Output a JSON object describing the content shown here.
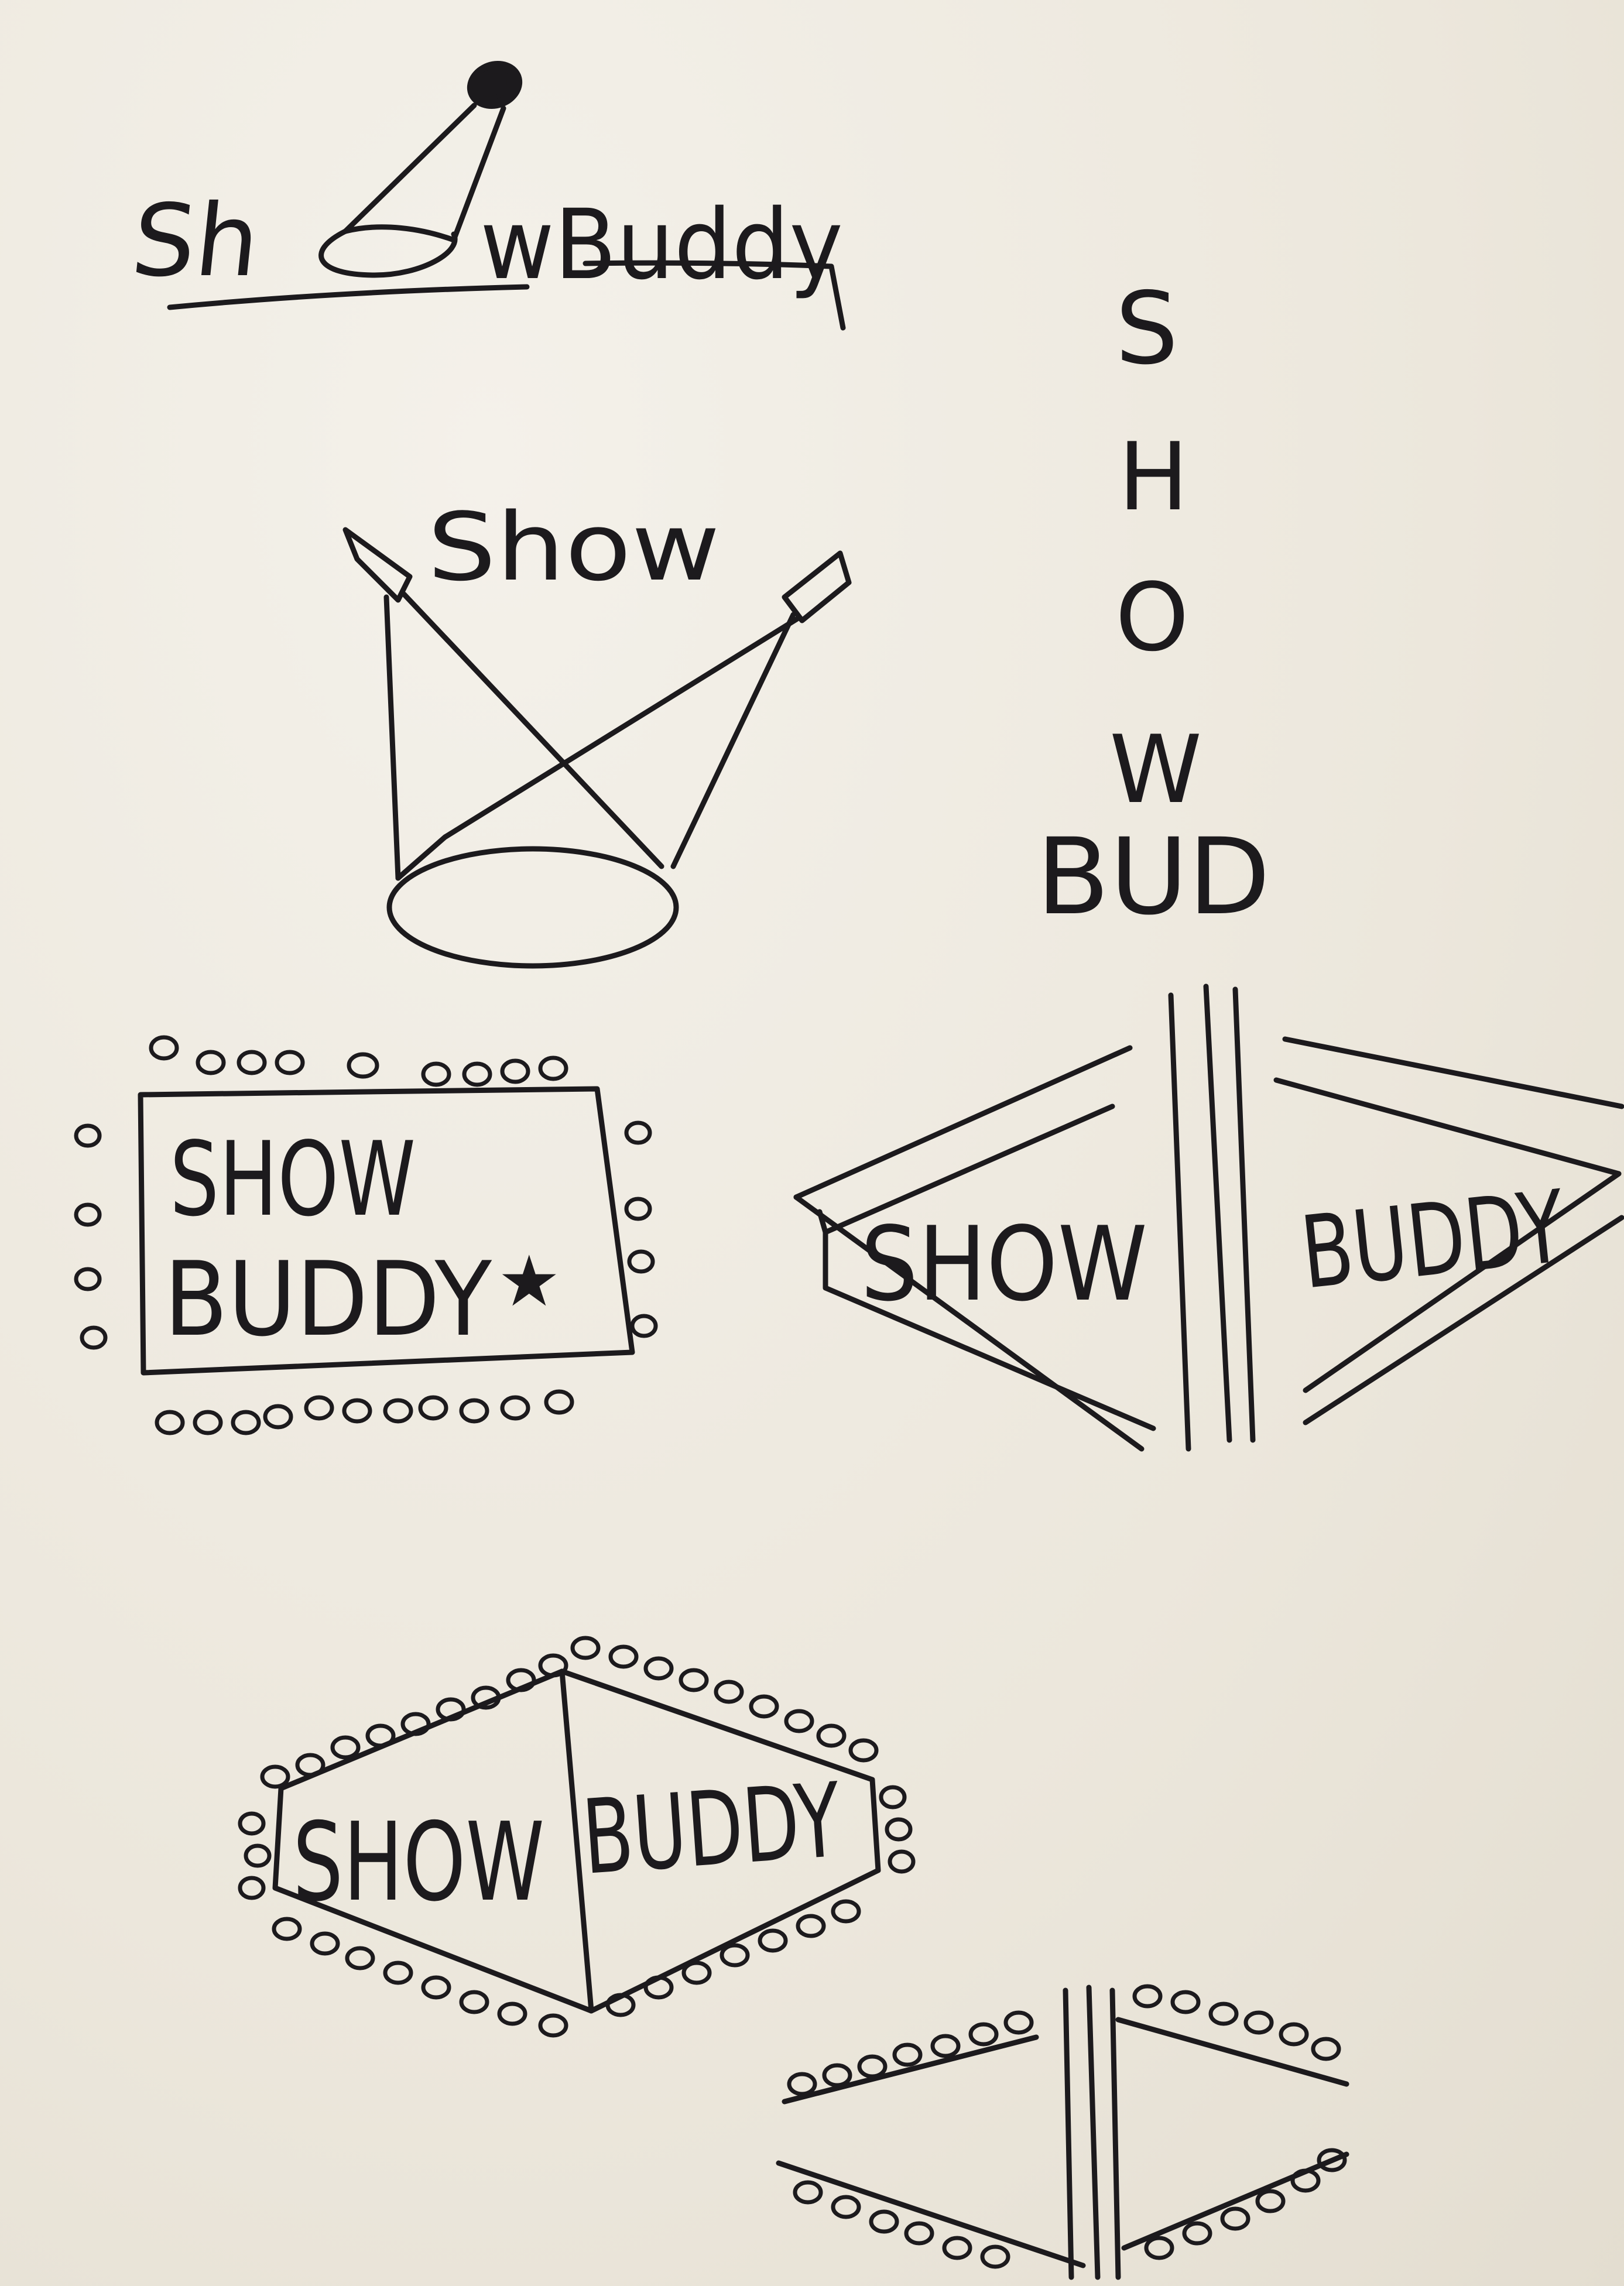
{
  "sketches": {
    "logo_1": {
      "left": "Sh",
      "right": "wBuddy"
    },
    "logo_2": {
      "word": "Show"
    },
    "logo_3": {
      "letters": [
        "S",
        "H",
        "O",
        "W",
        "BUD"
      ]
    },
    "logo_4": {
      "line1": "SHOW",
      "line2": "BUDDY",
      "mark": "★"
    },
    "logo_5": {
      "left": "SHOW",
      "right": "BUDDY"
    },
    "logo_6": {
      "left": "SHOW",
      "right": "BUDDY"
    }
  }
}
